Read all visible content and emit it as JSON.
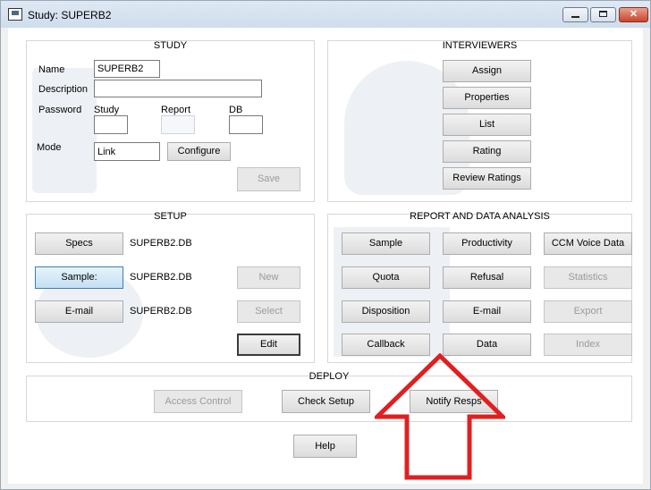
{
  "window": {
    "title": "Study: SUPERB2"
  },
  "titlebar": {
    "minimize_glyph": "",
    "maximize_glyph": "",
    "close_glyph": "✕"
  },
  "colors": {
    "arrow": "#e02020",
    "focus": "#3c7fb1"
  },
  "study": {
    "title": "STUDY",
    "name_label": "Name",
    "name_value": "SUPERB2",
    "description_label": "Description",
    "description_value": "",
    "password_label": "Password",
    "study_label": "Study",
    "study_value": "",
    "report_label": "Report",
    "report_value": "",
    "db_label": "DB",
    "db_value": "",
    "mode_label": "Mode",
    "mode_value": "Link",
    "configure_label": "Configure",
    "save_label": "Save"
  },
  "interviewers": {
    "title": "INTERVIEWERS",
    "buttons": [
      "Assign",
      "Properties",
      "List",
      "Rating",
      "Review Ratings"
    ]
  },
  "setup": {
    "title": "SETUP",
    "specs_label": "Specs",
    "specs_file": "SUPERB2.DB",
    "sample_label": "Sample:",
    "sample_file": "SUPERB2.DB",
    "email_label": "E-mail",
    "email_file": "SUPERB2.DB",
    "new_label": "New",
    "select_label": "Select",
    "edit_label": "Edit"
  },
  "report": {
    "title": "REPORT AND DATA ANALYSIS",
    "buttons": [
      "Sample",
      "Productivity",
      "CCM Voice Data",
      "Quota",
      "Refusal",
      "Statistics",
      "Disposition",
      "E-mail",
      "Export",
      "Callback",
      "Data",
      "Index"
    ]
  },
  "deploy": {
    "title": "DEPLOY",
    "access_control_label": "Access Control",
    "check_setup_label": "Check Setup",
    "notify_resps_label": "Notify Resps"
  },
  "help_label": "Help"
}
